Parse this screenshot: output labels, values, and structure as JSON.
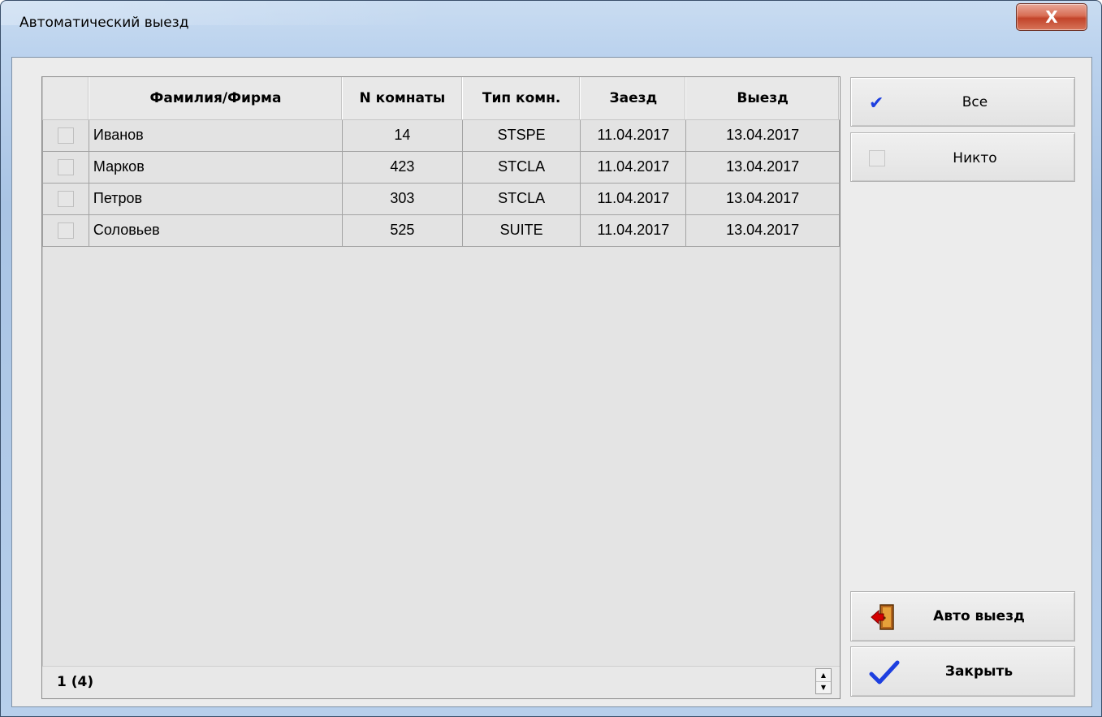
{
  "window": {
    "title": "Автоматический выезд",
    "close_label": "X"
  },
  "grid": {
    "columns": [
      "",
      "Фамилия/Фирма",
      "N комнаты",
      "Тип комн.",
      "Заезд",
      "Выезд"
    ],
    "rows": [
      {
        "checked": false,
        "name": "Иванов",
        "room": "14",
        "type": "STSPE",
        "arrival": "11.04.2017",
        "departure": "13.04.2017"
      },
      {
        "checked": false,
        "name": "Марков",
        "room": "423",
        "type": "STCLA",
        "arrival": "11.04.2017",
        "departure": "13.04.2017"
      },
      {
        "checked": false,
        "name": "Петров",
        "room": "303",
        "type": "STCLA",
        "arrival": "11.04.2017",
        "departure": "13.04.2017"
      },
      {
        "checked": false,
        "name": "Соловьев",
        "room": "525",
        "type": "SUITE",
        "arrival": "11.04.2017",
        "departure": "13.04.2017"
      }
    ],
    "status": "1 (4)"
  },
  "buttons": {
    "all_label": "Все",
    "none_label": "Никто",
    "auto_checkout_label": "Авто выезд",
    "close_label": "Закрыть"
  },
  "colors": {
    "accent_blue": "#1d3fe0",
    "door_red": "#d40000",
    "door_orange": "#d98a1e"
  },
  "icons": {
    "all": "check-icon",
    "none": "empty-checkbox-icon",
    "auto_checkout": "exit-door-icon",
    "close": "check-icon"
  }
}
